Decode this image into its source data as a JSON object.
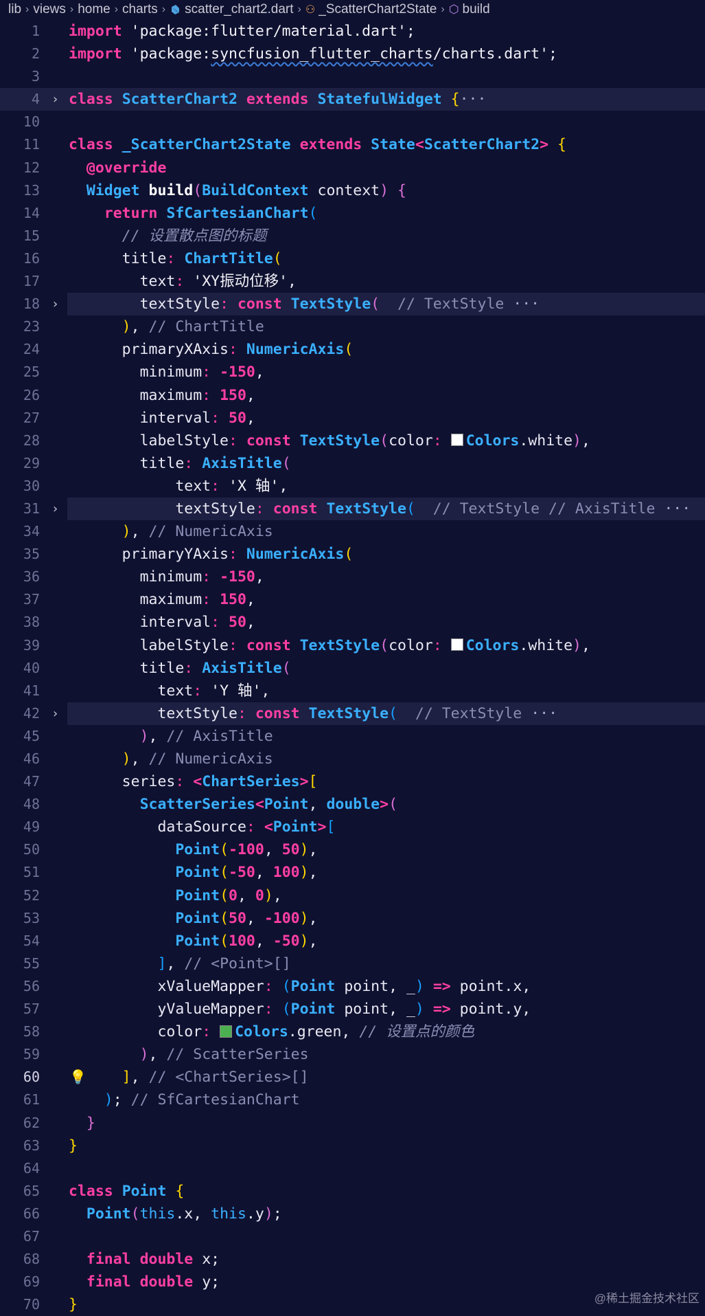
{
  "breadcrumb": [
    "lib",
    "views",
    "home",
    "charts",
    "scatter_chart2.dart",
    "_ScatterChart2State",
    "build"
  ],
  "current_line": "60",
  "colors": {
    "background": "#0f1130",
    "keyword": "#ff3fa4",
    "type": "#3ab0ff",
    "comment": "#8b8eb4"
  },
  "lines": [
    {
      "n": "1",
      "text": "import 'package:flutter/material.dart';"
    },
    {
      "n": "2",
      "text": "import 'package:syncfusion_flutter_charts/charts.dart';"
    },
    {
      "n": "3",
      "text": ""
    },
    {
      "n": "4",
      "text": "class ScatterChart2 extends StatefulWidget {···"
    },
    {
      "n": "10",
      "text": ""
    },
    {
      "n": "11",
      "text": "class _ScatterChart2State extends State<ScatterChart2> {"
    },
    {
      "n": "12",
      "text": "@override"
    },
    {
      "n": "13",
      "text": "Widget build(BuildContext context) {"
    },
    {
      "n": "14",
      "text": "return SfCartesianChart("
    },
    {
      "n": "15",
      "text": "// 设置散点图的标题"
    },
    {
      "n": "16",
      "text": "title: ChartTitle("
    },
    {
      "n": "17",
      "text": "text: 'XY振动位移',"
    },
    {
      "n": "18",
      "text": "textStyle: const TextStyle( // TextStyle ···"
    },
    {
      "n": "23",
      "text": "), // ChartTitle"
    },
    {
      "n": "24",
      "text": "primaryXAxis: NumericAxis("
    },
    {
      "n": "25",
      "text": "minimum: -150,"
    },
    {
      "n": "26",
      "text": "maximum: 150,"
    },
    {
      "n": "27",
      "text": "interval: 50,"
    },
    {
      "n": "28",
      "text": "labelStyle: const TextStyle(color: Colors.white),"
    },
    {
      "n": "29",
      "text": "title: AxisTitle("
    },
    {
      "n": "30",
      "text": "text: 'X 轴',"
    },
    {
      "n": "31",
      "text": "textStyle: const TextStyle( // TextStyle // AxisTitle ···"
    },
    {
      "n": "34",
      "text": "), // NumericAxis"
    },
    {
      "n": "35",
      "text": "primaryYAxis: NumericAxis("
    },
    {
      "n": "36",
      "text": "minimum: -150,"
    },
    {
      "n": "37",
      "text": "maximum: 150,"
    },
    {
      "n": "38",
      "text": "interval: 50,"
    },
    {
      "n": "39",
      "text": "labelStyle: const TextStyle(color: Colors.white),"
    },
    {
      "n": "40",
      "text": "title: AxisTitle("
    },
    {
      "n": "41",
      "text": "text: 'Y 轴',"
    },
    {
      "n": "42",
      "text": "textStyle: const TextStyle( // TextStyle ···"
    },
    {
      "n": "45",
      "text": "), // AxisTitle"
    },
    {
      "n": "46",
      "text": "), // NumericAxis"
    },
    {
      "n": "47",
      "text": "series: <ChartSeries>["
    },
    {
      "n": "48",
      "text": "ScatterSeries<Point, double>("
    },
    {
      "n": "49",
      "text": "dataSource: <Point>["
    },
    {
      "n": "50",
      "text": "Point(-100, 50),"
    },
    {
      "n": "51",
      "text": "Point(-50, 100),"
    },
    {
      "n": "52",
      "text": "Point(0, 0),"
    },
    {
      "n": "53",
      "text": "Point(50, -100),"
    },
    {
      "n": "54",
      "text": "Point(100, -50),"
    },
    {
      "n": "55",
      "text": "], // <Point>[]"
    },
    {
      "n": "56",
      "text": "xValueMapper: (Point point, _) => point.x,"
    },
    {
      "n": "57",
      "text": "yValueMapper: (Point point, _) => point.y,"
    },
    {
      "n": "58",
      "text": "color: Colors.green, // 设置点的颜色"
    },
    {
      "n": "59",
      "text": "), // ScatterSeries"
    },
    {
      "n": "60",
      "text": "], // <ChartSeries>[]"
    },
    {
      "n": "61",
      "text": "); // SfCartesianChart"
    },
    {
      "n": "62",
      "text": "}"
    },
    {
      "n": "63",
      "text": "}"
    },
    {
      "n": "64",
      "text": ""
    },
    {
      "n": "65",
      "text": "class Point {"
    },
    {
      "n": "66",
      "text": "Point(this.x, this.y);"
    },
    {
      "n": "67",
      "text": ""
    },
    {
      "n": "68",
      "text": "final double x;"
    },
    {
      "n": "69",
      "text": "final double y;"
    },
    {
      "n": "70",
      "text": "}"
    }
  ],
  "watermark": "@稀土掘金技术社区"
}
